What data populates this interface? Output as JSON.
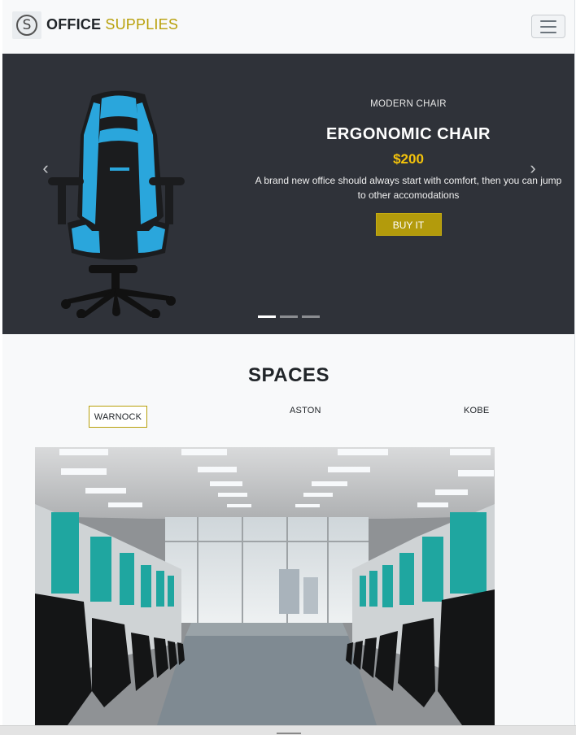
{
  "navbar": {
    "logo_letter": "S",
    "brand_first": "OFFICE",
    "brand_second": "SUPPLIES"
  },
  "carousel": {
    "slides_count": 3,
    "active_slide": 1,
    "subtitle": "MODERN CHAIR",
    "title": "ERGONOMIC CHAIR",
    "price": "$200",
    "description": "A brand new office should always start with comfort, then you can jump to other accomodations",
    "button": "BUY IT",
    "prev_icon": "‹",
    "next_icon": "›"
  },
  "spaces": {
    "title": "SPACES",
    "tabs": [
      {
        "label": "WARNOCK",
        "active": true
      },
      {
        "label": "ASTON",
        "active": false
      },
      {
        "label": "KOBE",
        "active": false
      }
    ]
  },
  "colors": {
    "accent": "#b8a00a",
    "price": "#f4c30b",
    "carousel_bg": "#2f3239",
    "chair_blue": "#2aa6dc",
    "cubicle_teal": "#1fa6a0"
  }
}
